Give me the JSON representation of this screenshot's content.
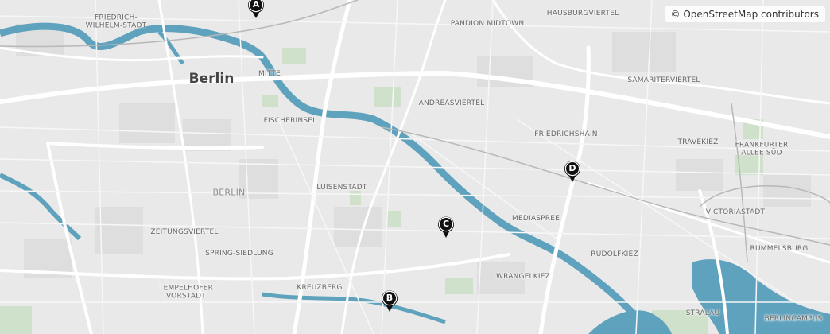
{
  "map": {
    "attribution": "© OpenStreetMap contributors",
    "colors": {
      "land": "#e9e9e9",
      "water": "#5fa2bd",
      "park": "#cfe0cb",
      "road": "#ffffff",
      "marker": "#111111"
    },
    "city_label": "Berlin",
    "district_label": "BERLIN",
    "places": {
      "friedrich_wilhelm_stadt": "FRIEDRICH-\nWILHELM-STADT",
      "mitte": "MITTE",
      "pandion_midtown": "PANDION MIDTOWN",
      "hausburgviertel": "HAUSBURGVIERTEL",
      "samariterviertel": "SAMARITERVIERTEL",
      "andreasviertel": "ANDREASVIERTEL",
      "fischerinsel": "FISCHERINSEL",
      "friedrichshain": "FRIEDRICHSHAIN",
      "travekiez": "TRAVEKIEZ",
      "frankfurter_allee_sud": "FRANKFURTER\nALLEE SÜD",
      "luisenstadt": "LUISENSTADT",
      "mediaspree": "MEDIASPREE",
      "victoriastadt": "VICTORIASTADT",
      "zeitungsviertel": "ZEITUNGSVIERTEL",
      "spring_siedlung": "SPRING-SIEDLUNG",
      "rudolfkiez": "RUDOLFKIEZ",
      "rummelsburg": "RUMMELSBURG",
      "wrangelkiez": "WRANGELKIEZ",
      "kreuzberg": "KREUZBERG",
      "tempelhofer_vorstadt": "TEMPELHOFER\nVORSTADT",
      "stralau": "STRALAU",
      "berlincampus": "BERLINCAMPUS"
    },
    "markers": [
      {
        "id": "A",
        "label": "A"
      },
      {
        "id": "B",
        "label": "B"
      },
      {
        "id": "C",
        "label": "C"
      },
      {
        "id": "D",
        "label": "D"
      }
    ]
  }
}
